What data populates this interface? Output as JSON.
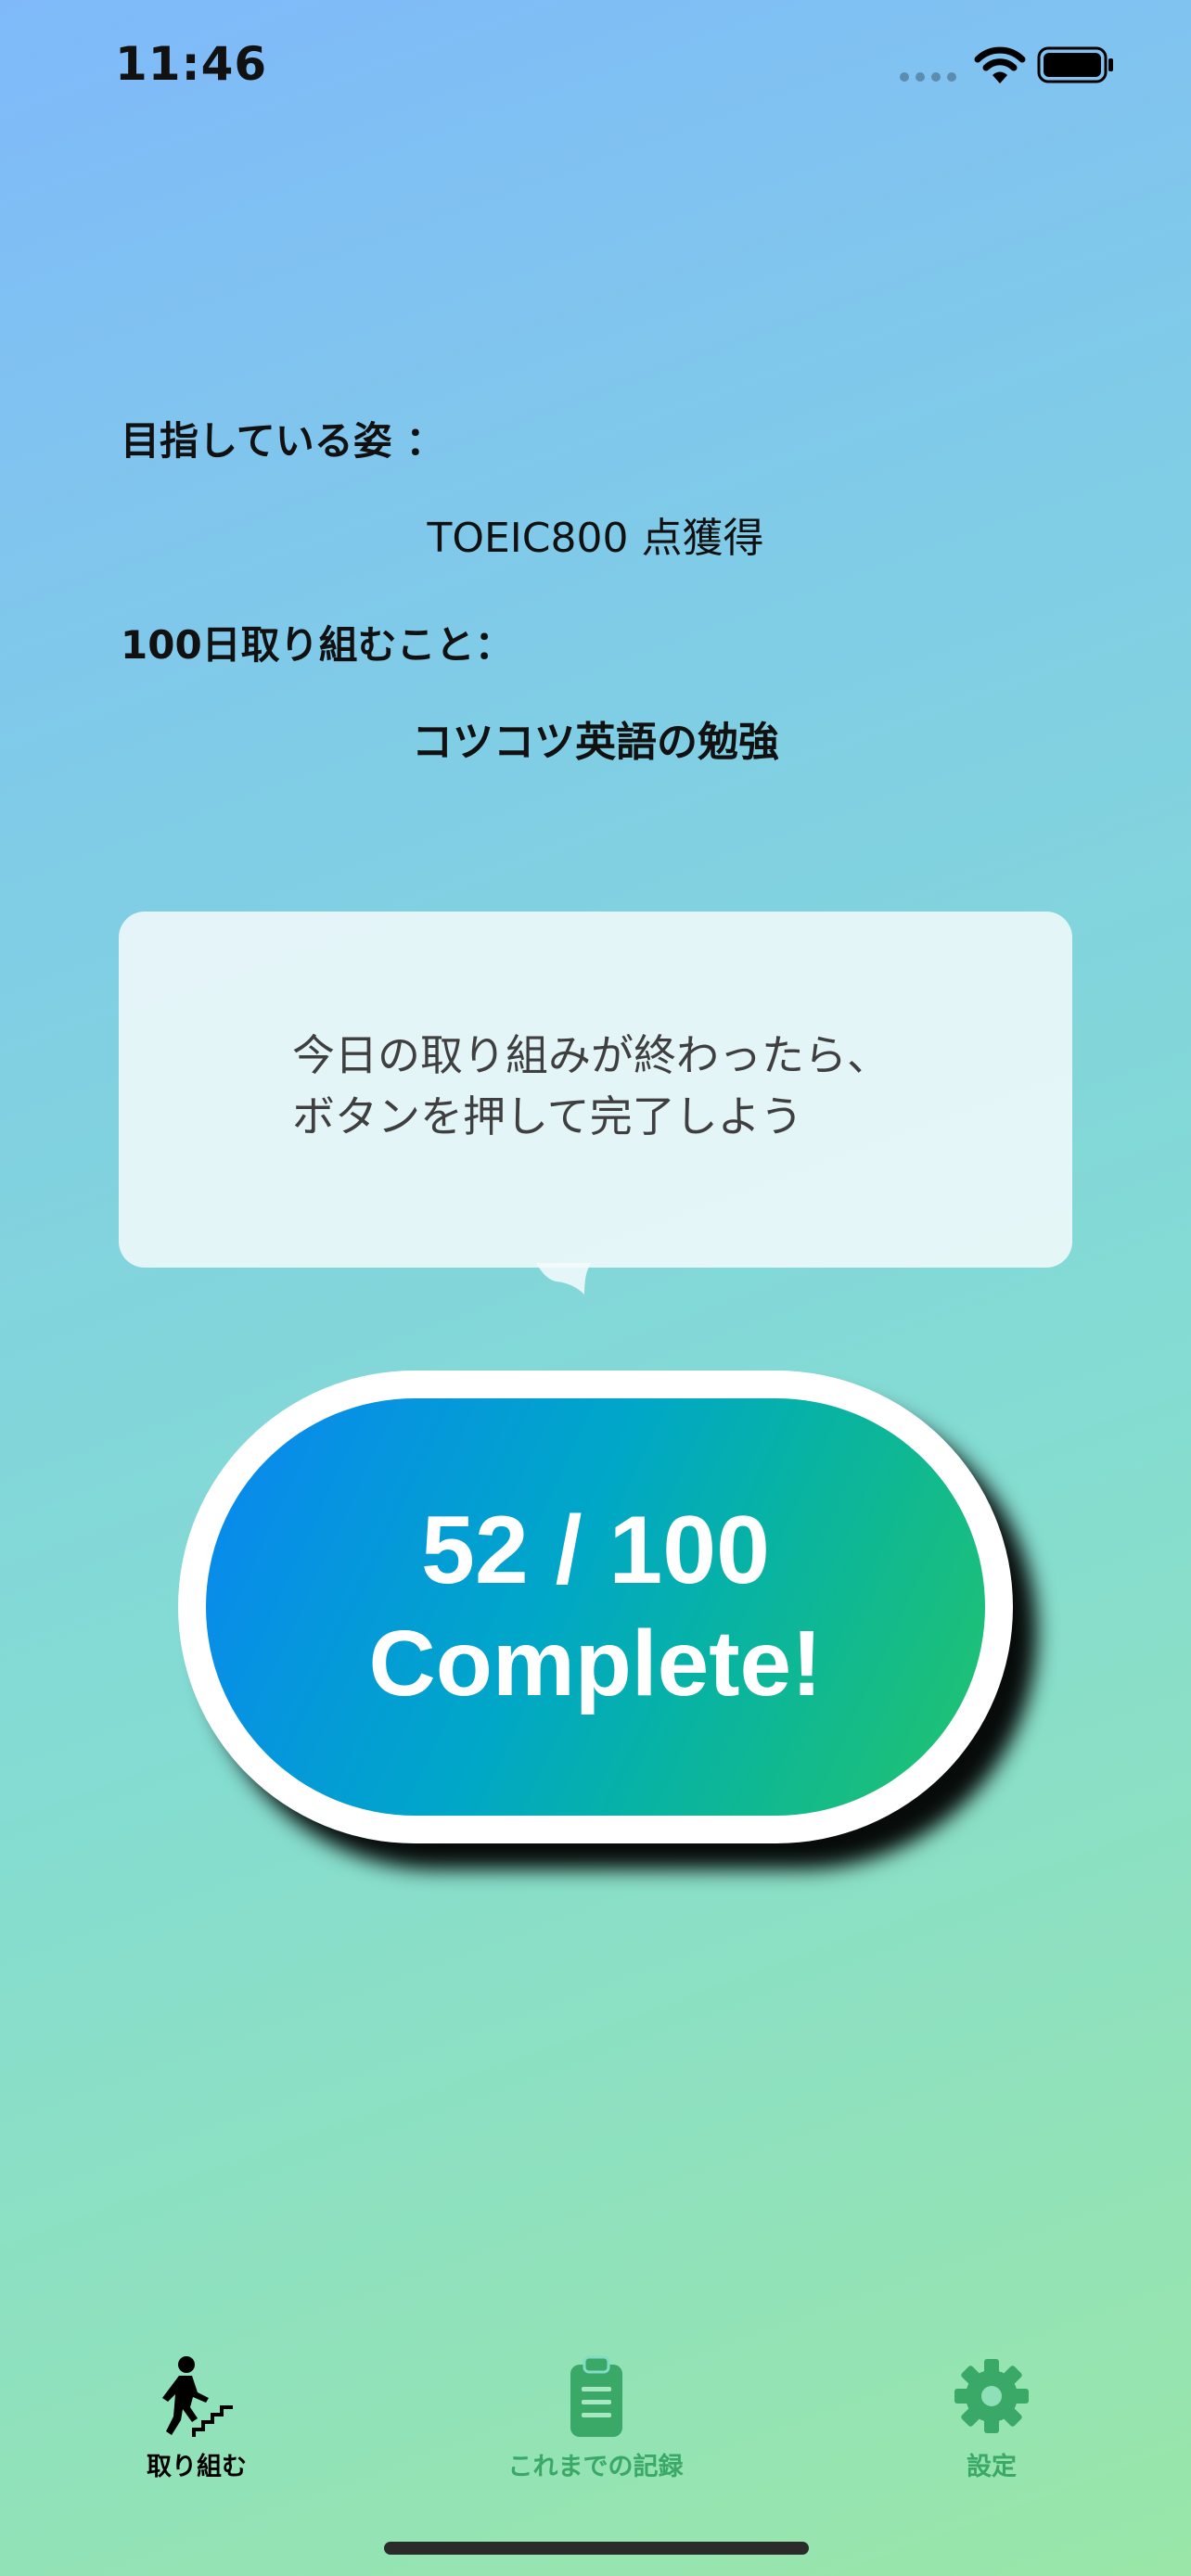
{
  "status_bar": {
    "time": "11:46",
    "icons": [
      "signal-dots-icon",
      "wifi-icon",
      "battery-icon"
    ]
  },
  "goal": {
    "label": "目指している姿 ：",
    "value": "TOEIC800 点獲得"
  },
  "task": {
    "label": "100日取り組むこと：",
    "value": "コツコツ英語の勉強"
  },
  "bubble": {
    "message": "今日の取り組みが終わったら、\nボタンを押して完了しよう"
  },
  "complete_button": {
    "progress": "52 / 100",
    "label": "Complete!",
    "current": 52,
    "total": 100
  },
  "tab_bar": {
    "tabs": [
      {
        "label": "取り組む",
        "icon": "person-climbing-stairs-icon",
        "active": true
      },
      {
        "label": "これまでの記録",
        "icon": "clipboard-icon",
        "active": false
      },
      {
        "label": "設定",
        "icon": "gear-icon",
        "active": false
      }
    ]
  },
  "colors": {
    "tab_active": "#000000",
    "tab_inactive": "#3aa867",
    "button_gradient_start": "#0a86f2",
    "button_gradient_end": "#22c46c"
  }
}
